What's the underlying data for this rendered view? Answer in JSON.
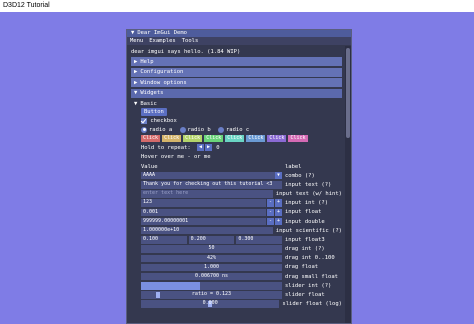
{
  "host": {
    "title": "D3D12 Tutorial"
  },
  "window": {
    "title": "Dear ImGui Demo",
    "collapse_glyph": "▼"
  },
  "menubar": [
    "Menu",
    "Examples",
    "Tools"
  ],
  "intro": "dear imgui says hello. (1.84 WIP)",
  "headers": [
    {
      "label": "Help",
      "glyph": "▶"
    },
    {
      "label": "Configuration",
      "glyph": "▶"
    },
    {
      "label": "Window options",
      "glyph": "▶"
    },
    {
      "label": "Widgets",
      "glyph": "▼"
    }
  ],
  "basic": {
    "label": "Basic",
    "glyph": "▼",
    "button_label": "Button",
    "checkbox_label": "checkbox",
    "radios": [
      {
        "label": "radio a",
        "on": true
      },
      {
        "label": "radio b",
        "on": false
      },
      {
        "label": "radio c",
        "on": false
      }
    ],
    "click_label": "Click",
    "click_colors": [
      "#d46a6a",
      "#d4b46a",
      "#b4d46a",
      "#6ad47a",
      "#6ad4c4",
      "#6a9ad4",
      "#8a6ad4",
      "#d46ab4"
    ],
    "hold_label": "Hold to repeat:",
    "hold_left": "◀",
    "hold_right": "▶",
    "hold_value": "0",
    "hover_text": "Hover over me - or me",
    "column_value": "Value",
    "column_label": "label"
  },
  "widgets": [
    {
      "kind": "combo",
      "value": "AAAA",
      "label": "combo (?)",
      "arrow": "▼"
    },
    {
      "kind": "text",
      "value": "Thank you for checking out this tutorial <3",
      "label": "input text (?)"
    },
    {
      "kind": "hint",
      "value": "enter text here",
      "label": "input text (w/ hint)"
    },
    {
      "kind": "pm",
      "value": "123",
      "label": "input int (?)"
    },
    {
      "kind": "pm",
      "value": "0.001",
      "label": "input float"
    },
    {
      "kind": "pm",
      "value": "999999.00000001",
      "label": "input double"
    },
    {
      "kind": "text",
      "value": "1.000000e+10",
      "label": "input scientific (?)"
    },
    {
      "kind": "triple",
      "values": [
        "0.100",
        "0.200",
        "0.300"
      ],
      "label": "input float3"
    },
    {
      "kind": "center",
      "value": "50",
      "label": "drag int (?)"
    },
    {
      "kind": "center",
      "value": "42%",
      "label": "drag int 0..100"
    },
    {
      "kind": "center",
      "value": "1.000",
      "label": "drag float"
    },
    {
      "kind": "center",
      "value": "0.006700 ns",
      "label": "drag small float"
    },
    {
      "kind": "slider_fill",
      "value": "",
      "fraction": 0.42,
      "label": "slider int (?)"
    },
    {
      "kind": "slider_grab",
      "value": "ratio = 0.123",
      "fraction": 0.123,
      "label": "slider float"
    },
    {
      "kind": "slider_grab",
      "value": "0.000",
      "fraction": 0.5,
      "label": "slider float (log)"
    }
  ]
}
